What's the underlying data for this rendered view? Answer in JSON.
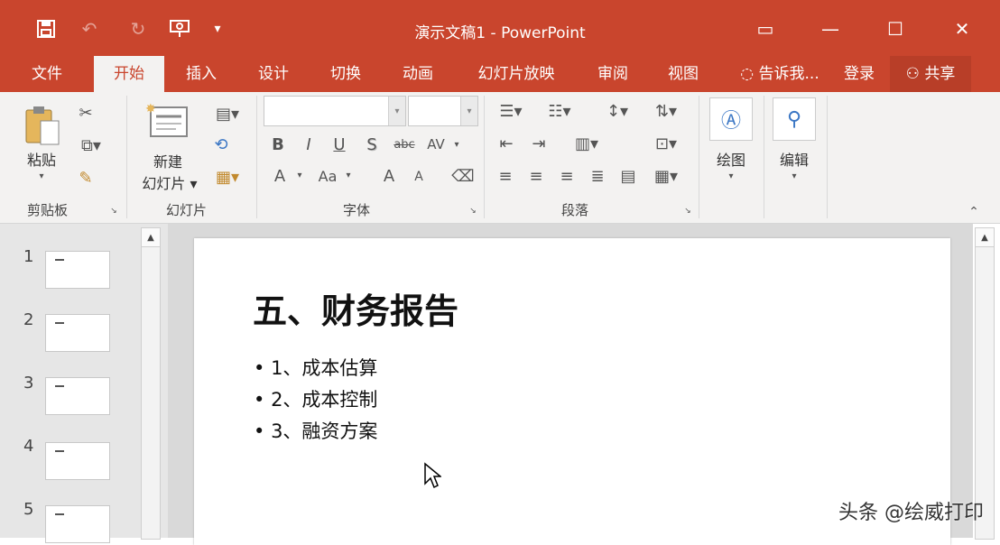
{
  "window": {
    "title": "演示文稿1 - PowerPoint",
    "quick_access": [
      {
        "name": "save-icon",
        "glyph": "▣"
      },
      {
        "name": "undo-icon",
        "glyph": "↶"
      },
      {
        "name": "redo-icon",
        "glyph": "↻"
      },
      {
        "name": "present-icon",
        "glyph": "⊡"
      },
      {
        "name": "customize-icon",
        "glyph": "▾"
      }
    ],
    "controls": {
      "ribbon_display": "▭",
      "minimize": "—",
      "maximize": "☐",
      "close": "✕"
    }
  },
  "tabs": [
    "文件",
    "开始",
    "插入",
    "设计",
    "切换",
    "动画",
    "幻灯片放映",
    "审阅",
    "视图"
  ],
  "active_tab": "开始",
  "tell_me": "告诉我...",
  "login": "登录",
  "share": "共享",
  "ribbon": {
    "clipboard": {
      "label": "剪贴板",
      "paste": "粘贴"
    },
    "slides": {
      "label": "幻灯片",
      "new_slide_line1": "新建",
      "new_slide_line2": "幻灯片"
    },
    "font": {
      "label": "字体",
      "bold": "B",
      "italic": "I",
      "underline": "U",
      "shadow": "S",
      "strike": "abc",
      "spacing": "AV",
      "font_color": "A",
      "change_case": "Aa",
      "grow": "A",
      "shrink": "A"
    },
    "paragraph": {
      "label": "段落"
    },
    "drawing": {
      "label": "绘图"
    },
    "editing": {
      "label": "编辑"
    }
  },
  "thumbnails": [
    "1",
    "2",
    "3",
    "4",
    "5"
  ],
  "slide": {
    "title": "五、财务报告",
    "bullets": [
      "1、成本估算",
      "2、成本控制",
      "3、融资方案"
    ]
  },
  "watermark": "头条 @绘威打印",
  "colors": {
    "accent": "#c9452d",
    "ribbon": "#f3f2f1"
  }
}
